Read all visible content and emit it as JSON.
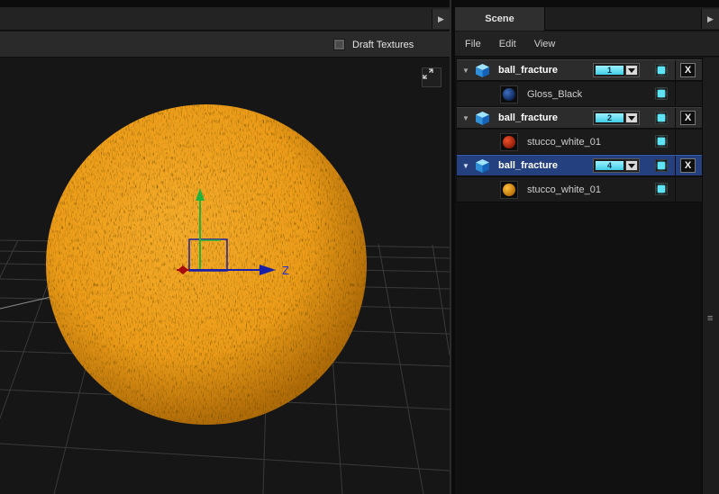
{
  "viewport": {
    "draft_textures_label": "Draft Textures",
    "axis_label_z": "Z"
  },
  "scene_panel": {
    "tab_label": "Scene",
    "menu": [
      "File",
      "Edit",
      "View"
    ],
    "objects": [
      {
        "name": "ball_fracture",
        "layer": "1",
        "material": "Gloss_Black",
        "material_color": "#1c3f7a",
        "selected": false
      },
      {
        "name": "ball_fracture",
        "layer": "2",
        "material": "stucco_white_01",
        "material_color": "#d43a1a",
        "selected": false
      },
      {
        "name": "ball_fracture",
        "layer": "4",
        "material": "stucco_white_01",
        "material_color": "#f0a01a",
        "selected": true
      }
    ],
    "delete_label": "X"
  },
  "colors": {
    "selection": "#25407e",
    "layer_highlight": "#5ee3f5",
    "sphere_orange": "#f0a21a"
  }
}
